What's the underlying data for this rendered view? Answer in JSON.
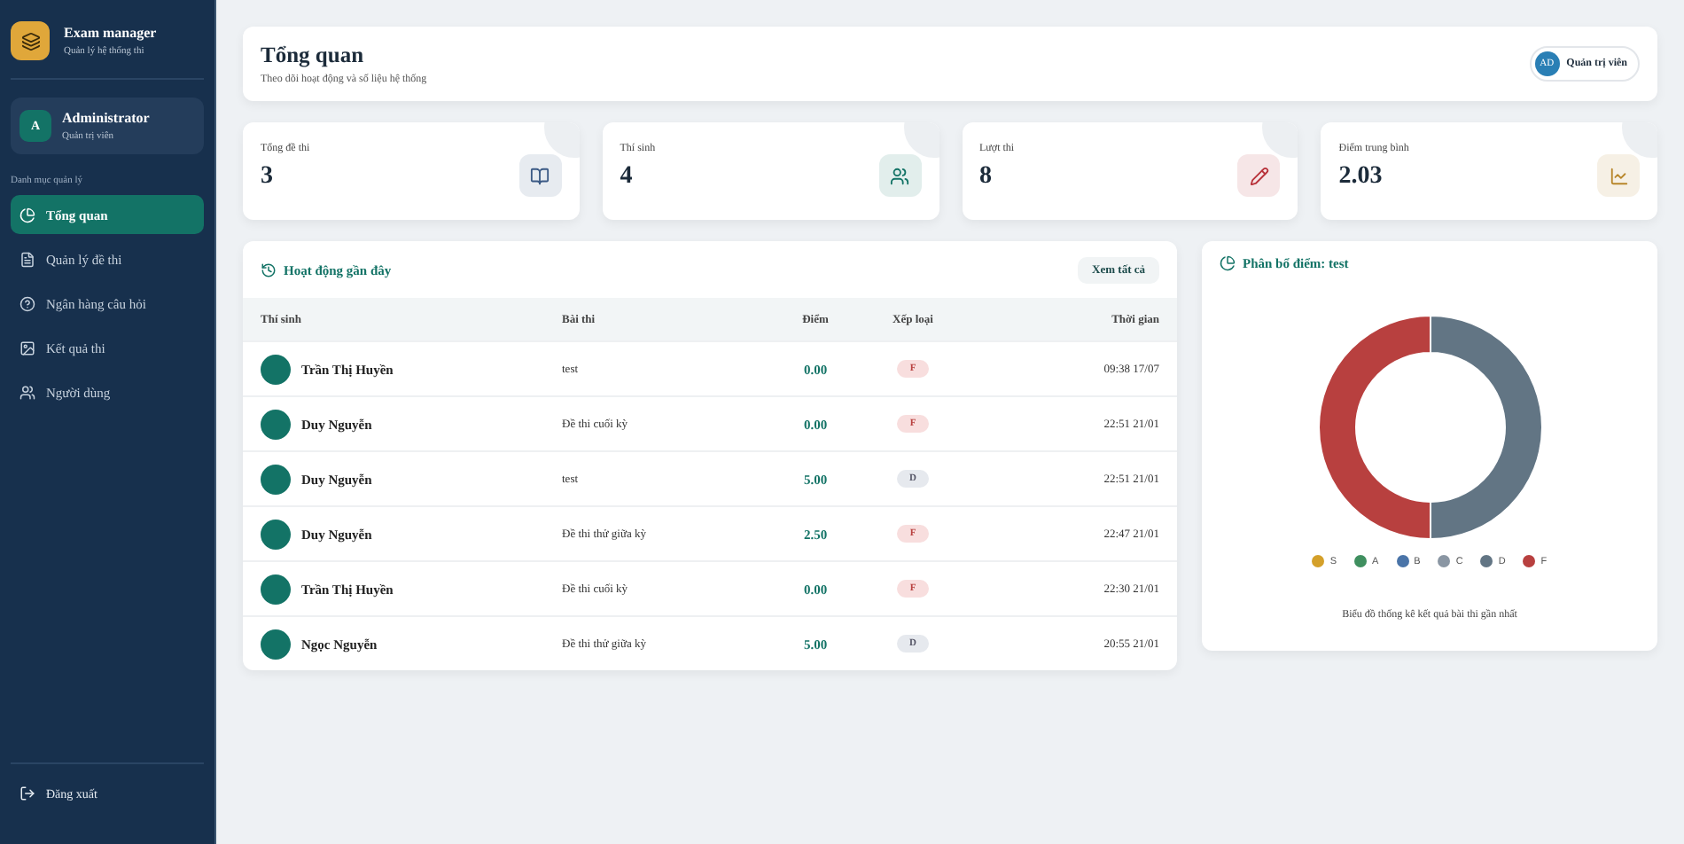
{
  "brand": {
    "title": "Exam manager",
    "subtitle": "Quản lý hệ thống thi"
  },
  "user": {
    "initial": "A",
    "name": "Administrator",
    "role": "Quản trị viên"
  },
  "nav_section": "Danh mục quản lý",
  "nav": [
    {
      "label": "Tổng quan",
      "selected": true
    },
    {
      "label": "Quản lý đề thi",
      "selected": false
    },
    {
      "label": "Ngân hàng câu hỏi",
      "selected": false
    },
    {
      "label": "Kết quả thi",
      "selected": false
    },
    {
      "label": "Người dùng",
      "selected": false
    }
  ],
  "logout": "Đăng xuất",
  "header": {
    "title": "Tổng quan",
    "subtitle": "Theo dõi hoạt động và số liệu hệ thống",
    "badge_initials": "AD",
    "badge_label": "Quản trị viên"
  },
  "stats": [
    {
      "label": "Tổng đề thi",
      "value": "3",
      "color": "#3b5a85"
    },
    {
      "label": "Thí sinh",
      "value": "4",
      "color": "#137366"
    },
    {
      "label": "Lượt thi",
      "value": "8",
      "color": "#b8323a"
    },
    {
      "label": "Điểm trung bình",
      "value": "2.03",
      "color": "#b8862a"
    }
  ],
  "activity": {
    "title": "Hoạt động gần đây",
    "button": "Xem tất cả",
    "columns": [
      "Thí sinh",
      "Bài thi",
      "Điểm",
      "Xếp loại",
      "Thời gian"
    ],
    "rows": [
      {
        "student": "Trần Thị Huyền",
        "exam": "test",
        "score": "0.00",
        "grade": "F",
        "time": "09:38 17/07"
      },
      {
        "student": "Duy Nguyễn",
        "exam": "Đề thi cuối kỳ",
        "score": "0.00",
        "grade": "F",
        "time": "22:51 21/01"
      },
      {
        "student": "Duy Nguyễn",
        "exam": "test",
        "score": "5.00",
        "grade": "D",
        "time": "22:51 21/01"
      },
      {
        "student": "Duy Nguyễn",
        "exam": "Đề thi thử giữa kỳ",
        "score": "2.50",
        "grade": "F",
        "time": "22:47 21/01"
      },
      {
        "student": "Trần Thị Huyền",
        "exam": "Đề thi cuối kỳ",
        "score": "0.00",
        "grade": "F",
        "time": "22:30 21/01"
      },
      {
        "student": "Ngọc Nguyễn",
        "exam": "Đề thi thử giữa kỳ",
        "score": "5.00",
        "grade": "D",
        "time": "20:55 21/01"
      }
    ]
  },
  "distribution": {
    "title": "Phân bổ điểm: test",
    "caption": "Biểu đồ thống kê kết quả bài thi gần nhất",
    "chart_data": {
      "type": "donut",
      "categories": [
        "S",
        "A",
        "B",
        "C",
        "D",
        "F"
      ],
      "values": [
        0,
        0,
        0,
        0,
        50,
        50
      ],
      "colors": [
        "#d4a02a",
        "#3f8f5f",
        "#4a74a8",
        "#8a96a3",
        "#627584",
        "#b8403f"
      ]
    }
  }
}
